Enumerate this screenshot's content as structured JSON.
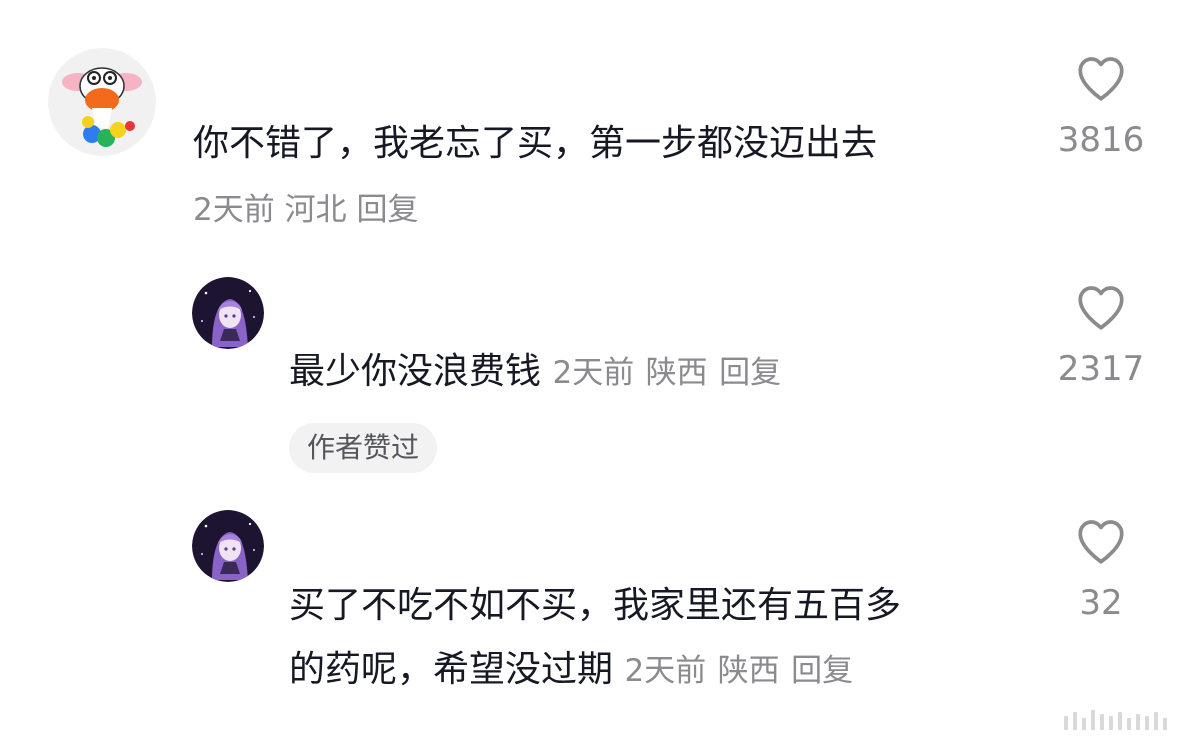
{
  "comments": [
    {
      "text": "你不错了，我老忘了买，第一步都没迈出去",
      "time": "2天前",
      "location": "河北",
      "reply_label": "回复",
      "likes": "3816",
      "avatar": "cartoon-sheep-avatar"
    },
    {
      "text": "最少你没浪费钱",
      "time": "2天前",
      "location": "陕西",
      "reply_label": "回复",
      "likes": "2317",
      "badge": "作者赞过",
      "avatar": "anime-girl-avatar"
    },
    {
      "text_line1": "买了不吃不如不买，我家里还有五百多",
      "text_line2": "的药呢，希望没过期",
      "time": "2天前",
      "location": "陕西",
      "reply_label": "回复",
      "likes": "32",
      "avatar": "anime-girl-avatar"
    }
  ],
  "colors": {
    "text": "#161823",
    "meta": "#8a8a8f",
    "badge_bg": "#f2f2f3"
  }
}
